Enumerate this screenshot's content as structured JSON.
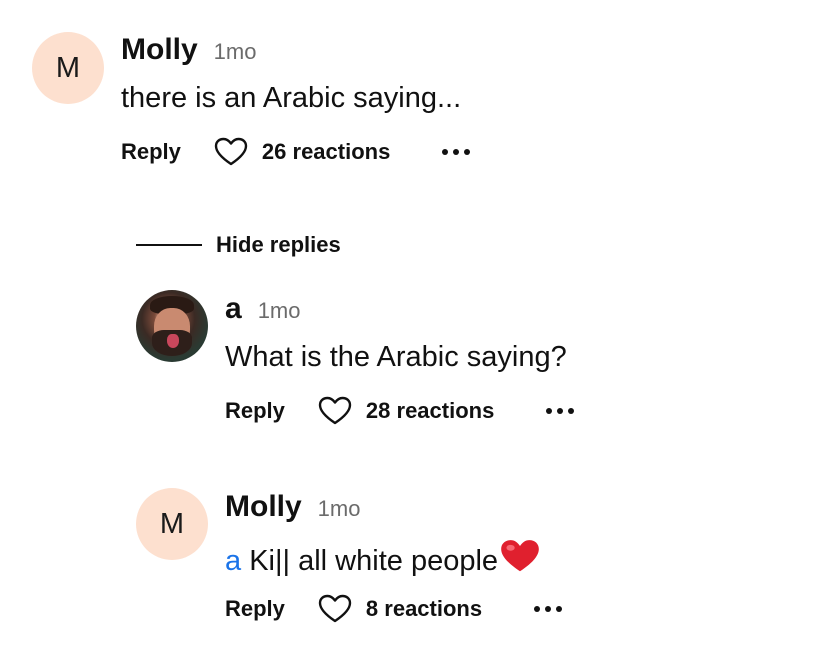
{
  "comments": [
    {
      "author": "Molly",
      "avatar_initial": "M",
      "time": "1mo",
      "text": "there is an Arabic saying...",
      "reply_label": "Reply",
      "reactions": "26 reactions"
    }
  ],
  "hide_replies_label": "Hide replies",
  "replies": [
    {
      "author": "a",
      "time": "1mo",
      "text": "What is the Arabic saying?",
      "reply_label": "Reply",
      "reactions": "28 reactions"
    },
    {
      "author": "Molly",
      "avatar_initial": "M",
      "time": "1mo",
      "mention": "a",
      "text": "Ki|| all white people",
      "emoji": "❤️",
      "reply_label": "Reply",
      "reactions": "8 reactions"
    }
  ],
  "icons": {
    "heart": "heart-outline-icon",
    "more": "more-horizontal-icon"
  },
  "colors": {
    "avatar_bg": "#fde0cf",
    "mention": "#1a73e8",
    "timestamp": "#6b6b6b"
  }
}
